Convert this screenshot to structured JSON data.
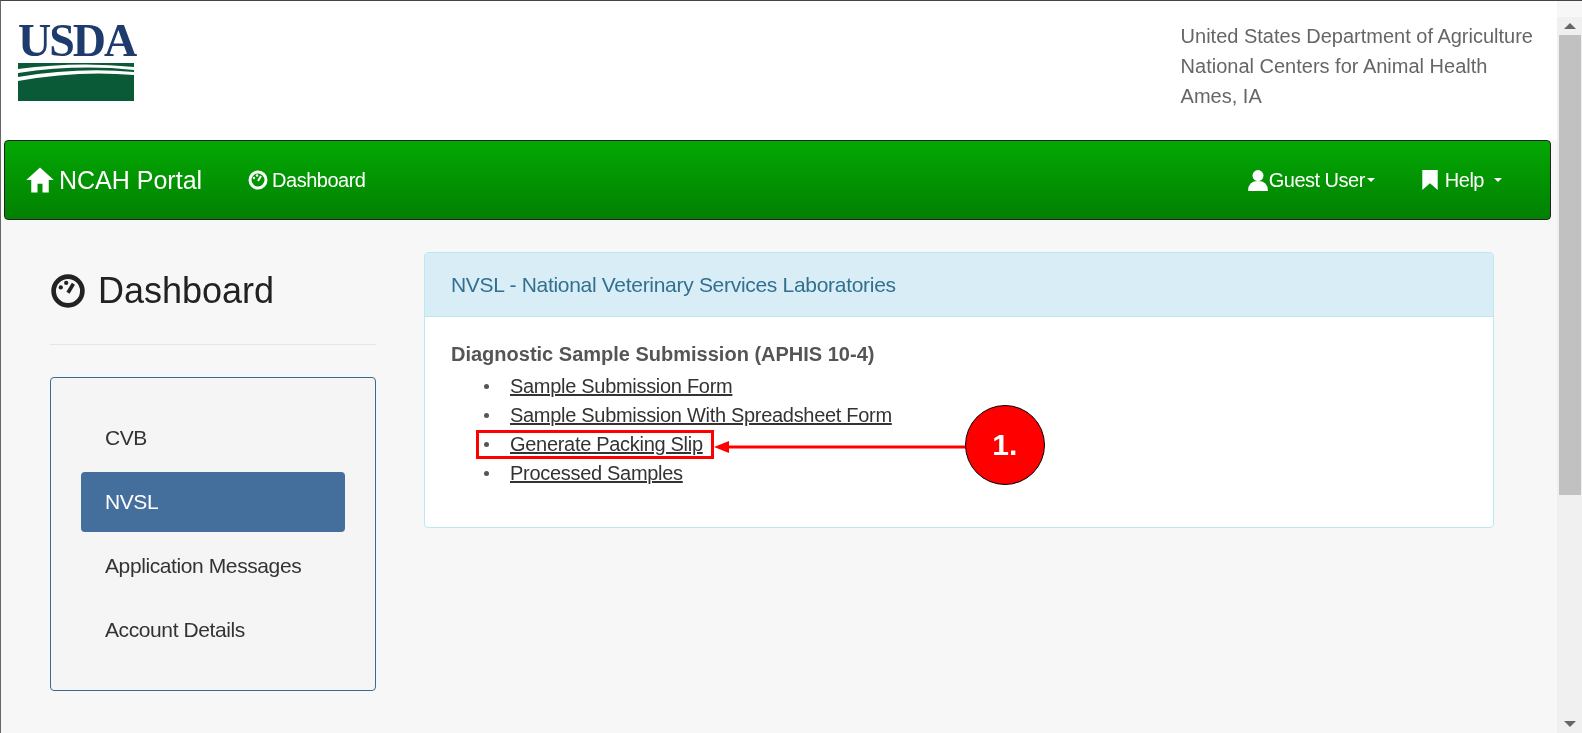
{
  "header": {
    "logo": "USDA",
    "agency_lines": [
      "United States Department of Agriculture",
      "National Centers for Animal Health",
      "Ames, IA"
    ]
  },
  "navbar": {
    "brand": "NCAH Portal",
    "links": [
      "Dashboard"
    ],
    "user_menu": "Guest User",
    "help_menu": "Help"
  },
  "page_title": "Dashboard",
  "sidebar": {
    "items": [
      {
        "label": "CVB",
        "selected": false
      },
      {
        "label": "NVSL",
        "selected": true
      },
      {
        "label": "Application Messages",
        "selected": false
      },
      {
        "label": "Account Details",
        "selected": false
      }
    ]
  },
  "panel": {
    "title": "NVSL - National Veterinary Services Laboratories",
    "section": "Diagnostic Sample Submission (APHIS 10-4)",
    "links": [
      {
        "label": "Sample Submission Form",
        "highlighted": false
      },
      {
        "label": "Sample Submission With Spreadsheet Form",
        "highlighted": false
      },
      {
        "label": "Generate Packing Slip",
        "highlighted": true
      },
      {
        "label": "Processed Samples",
        "highlighted": false
      }
    ]
  },
  "callout": {
    "label": "1."
  }
}
